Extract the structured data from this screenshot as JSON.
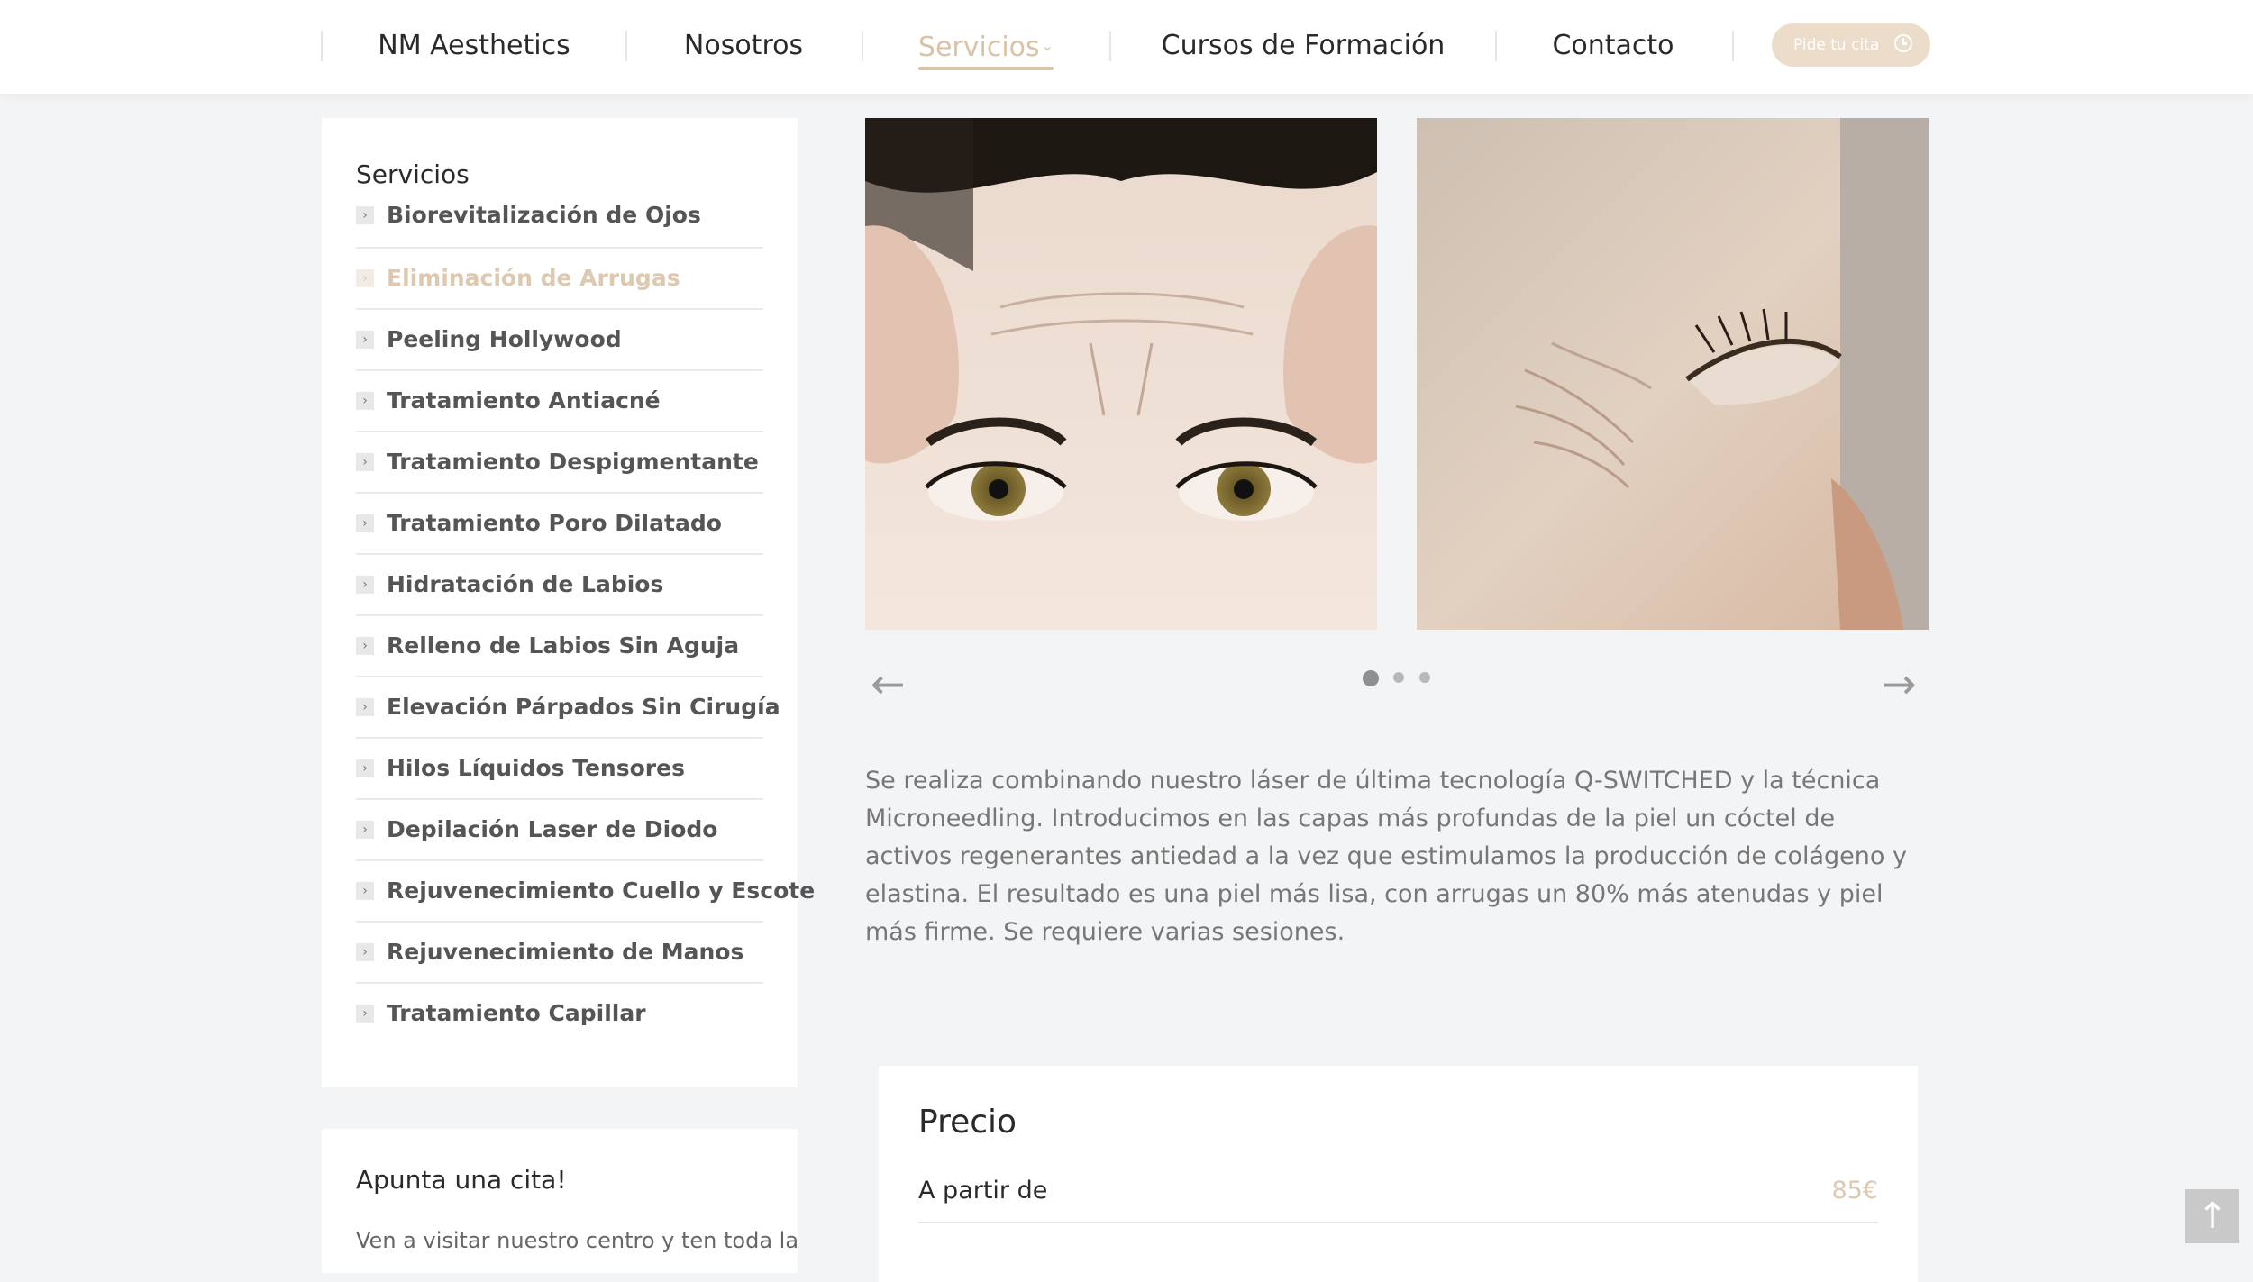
{
  "nav": {
    "items": [
      {
        "label": "NM Aesthetics"
      },
      {
        "label": "Nosotros"
      },
      {
        "label": "Servicios"
      },
      {
        "label": "Cursos de Formación"
      },
      {
        "label": "Contacto"
      }
    ],
    "active_index": 2,
    "cta_label": "Pide tu cita",
    "cta_icon": "clock-icon"
  },
  "sidebar": {
    "services_title": "Servicios",
    "services": [
      "Biorevitalización de Ojos",
      "Eliminación de Arrugas",
      "Peeling Hollywood",
      "Tratamiento Antiacné",
      "Tratamiento Despigmentante",
      "Tratamiento Poro Dilatado",
      "Hidratación de Labios",
      "Relleno de Labios Sin Aguja",
      "Elevación Párpados Sin Cirugía",
      "Hilos Líquidos Tensores",
      "Depilación Laser de Diodo",
      "Rejuvenecimiento Cuello y Escote",
      "Rejuvenecimiento de Manos",
      "Tratamiento Capillar"
    ],
    "active_service_index": 1,
    "cita_title": "Apunta una cita!",
    "cita_text": "Ven a visitar nuestro centro y ten toda la"
  },
  "carousel": {
    "slides_total": 3,
    "current_slide": 1
  },
  "description": "Se realiza combinando nuestro láser de última tecnología Q-SWITCHED y la técnica Microneedling. Introducimos en las capas más profundas de la piel un cóctel de activos regenerantes antiedad a la vez que estimulamos la producción de colágeno y elastina. El resultado es una piel más lisa, con arrugas un 80% más atenudas y piel más firme. Se requiere varias sesiones.",
  "price": {
    "title": "Precio",
    "label": "A partir de",
    "value": "85€"
  },
  "colors": {
    "accent": "#d9c3a6",
    "cta_background": "#ecdcca",
    "page_background": "#f3f4f6"
  }
}
